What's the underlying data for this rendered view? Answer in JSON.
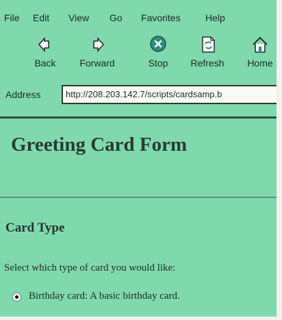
{
  "menu": [
    {
      "id": "file",
      "label": "File"
    },
    {
      "id": "edit",
      "label": "Edit"
    },
    {
      "id": "view",
      "label": "View"
    },
    {
      "id": "go",
      "label": "Go"
    },
    {
      "id": "favorites",
      "label": "Favorites"
    },
    {
      "id": "help",
      "label": "Help"
    }
  ],
  "toolbar": {
    "back": {
      "label": "Back",
      "icon": "arrow-left-icon"
    },
    "forward": {
      "label": "Forward",
      "icon": "arrow-right-icon"
    },
    "stop": {
      "label": "Stop",
      "icon": "stop-icon"
    },
    "refresh": {
      "label": "Refresh",
      "icon": "refresh-icon"
    },
    "home": {
      "label": "Home",
      "icon": "home-icon"
    }
  },
  "address": {
    "label": "Address",
    "value": "http://208.203.142.7/scripts/cardsamp.b"
  },
  "page": {
    "title": "Greeting Card Form",
    "section_heading": "Card Type",
    "prompt": "Select which type of card you would like:",
    "option": {
      "label": "Birthday card: A basic birthday card.",
      "checked": true
    }
  },
  "colors": {
    "window_bg": "#7fd9ad",
    "text": "#2a3a34",
    "stop_icon": "#2e8f7f"
  }
}
